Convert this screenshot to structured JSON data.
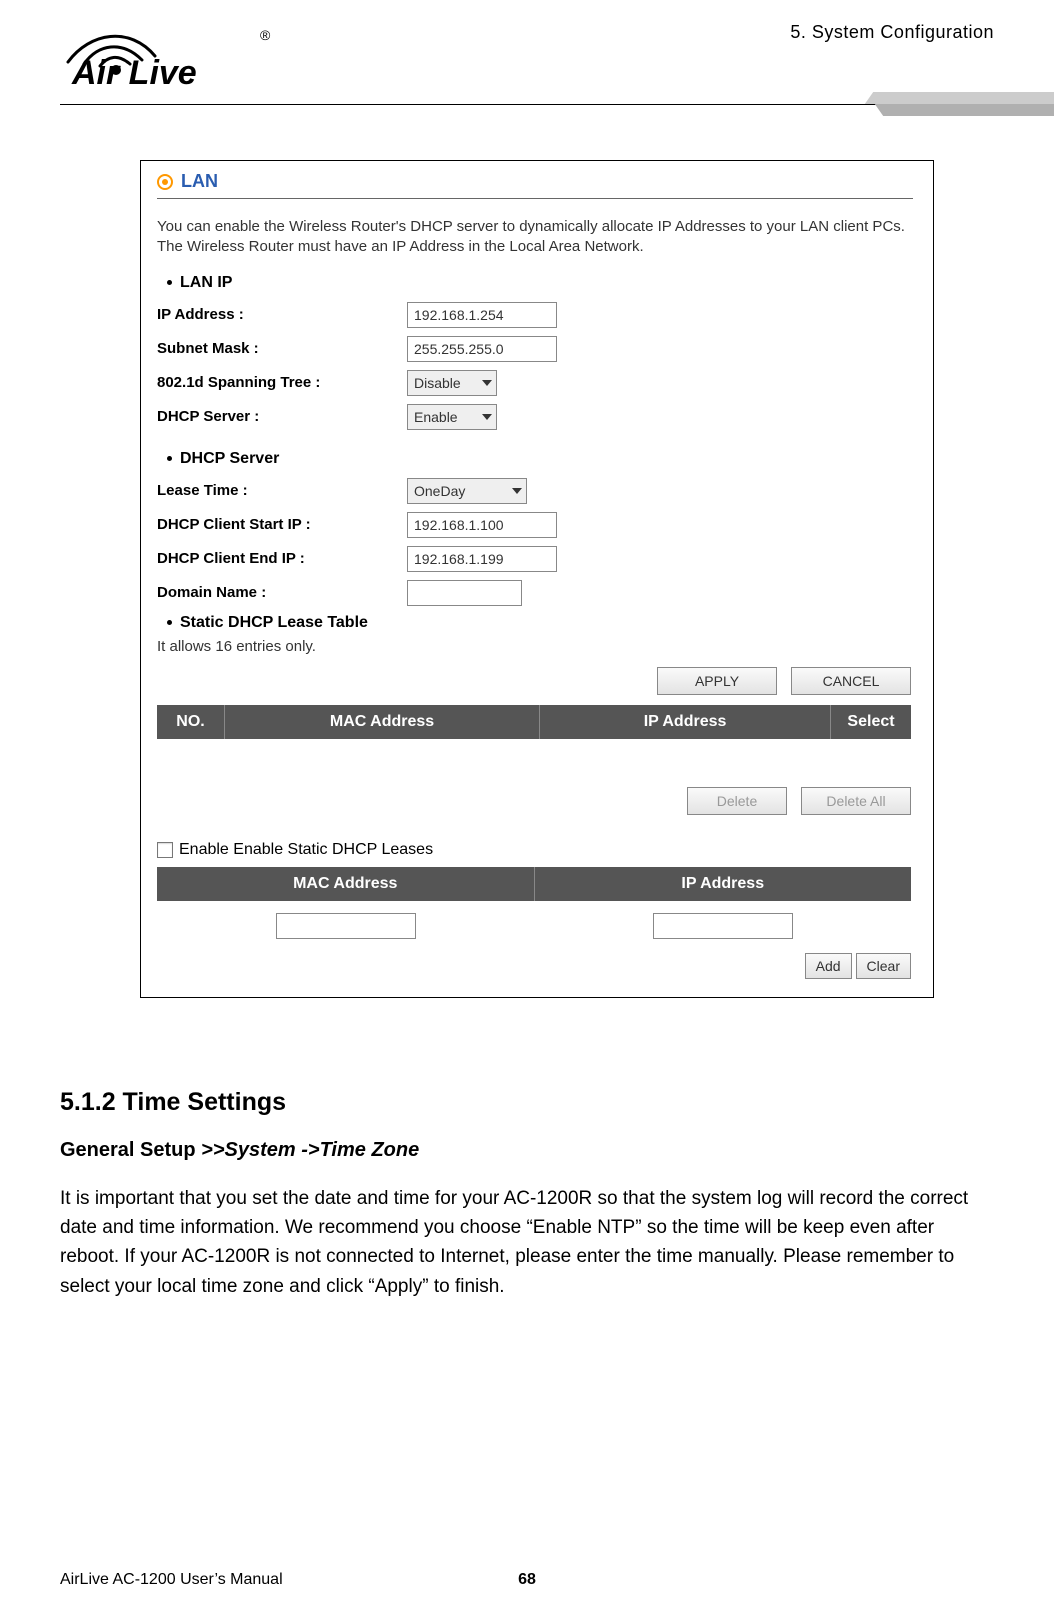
{
  "header": {
    "chapter": "5.  System  Configuration",
    "logo_text_main": "Air Live",
    "logo_reg": "®"
  },
  "screenshot": {
    "section_title": "LAN",
    "intro": "You can enable the Wireless Router's DHCP server to dynamically allocate IP Addresses to your LAN client PCs. The Wireless Router must have an IP Address in the Local Area Network.",
    "lan_ip": {
      "title": "LAN IP",
      "rows": {
        "ip_label": "IP Address :",
        "ip_value": "192.168.1.254",
        "subnet_label": "Subnet Mask :",
        "subnet_value": "255.255.255.0",
        "span_label": "802.1d Spanning Tree :",
        "span_value": "Disable",
        "dhcp_label": "DHCP Server :",
        "dhcp_value": "Enable"
      }
    },
    "dhcp": {
      "title": "DHCP Server",
      "lease_label": "Lease Time :",
      "lease_value": "OneDay",
      "start_label": "DHCP Client Start IP :",
      "start_value": "192.168.1.100",
      "end_label": "DHCP Client End IP :",
      "end_value": "192.168.1.199",
      "domain_label": "Domain Name :",
      "domain_value": ""
    },
    "static_table": {
      "title": "Static DHCP Lease Table",
      "note": "It allows 16 entries only.",
      "apply_btn": "APPLY",
      "cancel_btn": "CANCEL",
      "cols": {
        "no": "NO.",
        "mac": "MAC Address",
        "ip": "IP Address",
        "sel": "Select"
      },
      "delete_btn": "Delete",
      "delete_all_btn": "Delete All"
    },
    "enable_static": {
      "label": "Enable Enable Static DHCP Leases",
      "cols": {
        "mac": "MAC Address",
        "ip": "IP Address"
      },
      "mac_input": "",
      "ip_input": "",
      "add_btn": "Add",
      "clear_btn": "Clear"
    }
  },
  "doc": {
    "h2": "5.1.2 Time Settings",
    "h3_prefix": "General Setup ",
    "h3_italic": ">>System ->Time Zone",
    "para": "It is important that you set the date and time for your AC-1200R so that the system log will record the correct date and time information. We recommend you choose “Enable NTP” so the time will be keep even after reboot. If your AC-1200R is not connected to Internet, please enter the time manually. Please remember to select your local time zone and click “Apply” to finish."
  },
  "footer": {
    "manual": "AirLive AC-1200 User’s Manual",
    "page": "68"
  }
}
